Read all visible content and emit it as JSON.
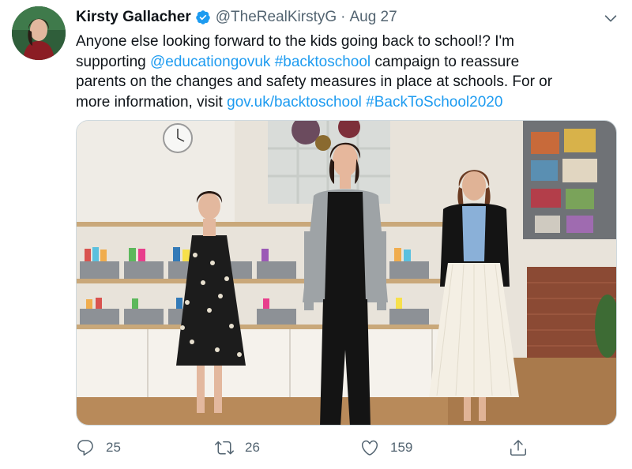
{
  "tweet": {
    "display_name": "Kirsty Gallacher",
    "handle": "@TheRealKirstyG",
    "separator": "·",
    "timestamp": "Aug 27",
    "text": {
      "line1": "Anyone else looking forward to the kids going back to school!? I'm",
      "line2_pre": "supporting ",
      "mention": "@educationgovuk",
      "line2_space": " ",
      "hashtag1": "#backtoschool",
      "line2_post": " campaign to reassure",
      "line3": "parents on the changes and safety measures in place at schools. For or",
      "line4_pre": "more information, visit ",
      "url": "gov.uk/backtoschool",
      "line4_space": " ",
      "hashtag2": "#BackToSchool2020"
    }
  },
  "actions": {
    "reply_count": "25",
    "retweet_count": "26",
    "like_count": "159"
  },
  "icons": {
    "verified": "verified-badge-icon",
    "more": "chevron-down-icon",
    "reply": "reply-icon",
    "retweet": "retweet-icon",
    "like": "heart-icon",
    "share": "share-icon"
  },
  "colors": {
    "link": "#1d9bf0",
    "secondary_text": "#536471",
    "primary_text": "#0f1419",
    "verified": "#1d9bf0"
  }
}
